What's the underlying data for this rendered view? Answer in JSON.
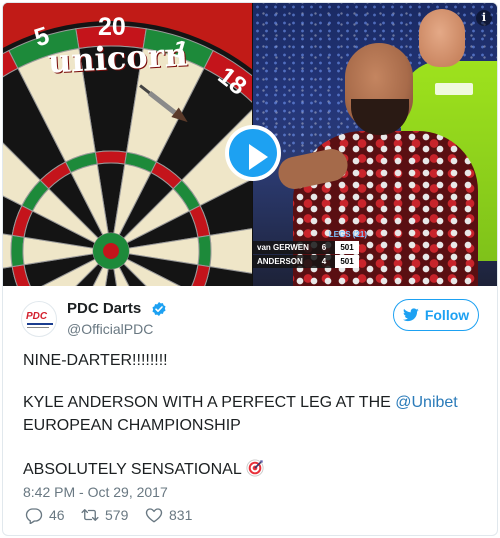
{
  "media": {
    "board_numbers": [
      "5",
      "20",
      "1",
      "18"
    ],
    "brand": "unicorn",
    "scoreboard": {
      "header": "LEGS (21)",
      "rows": [
        {
          "name": "van GERWEN",
          "legs": "6",
          "score": "501"
        },
        {
          "name": "ANDERSON",
          "legs": "4",
          "score": "501"
        }
      ]
    },
    "info_icon": "i",
    "play_icon": "play-icon"
  },
  "author": {
    "avatar_text": "PDC",
    "display_name": "PDC Darts",
    "handle": "@OfficialPDC",
    "verified_icon": "verified-badge-icon"
  },
  "follow_button": {
    "label": "Follow",
    "icon": "twitter-bird-icon"
  },
  "tweet": {
    "line1": "NINE-DARTER!!!!!!!!",
    "line2_prefix": "KYLE ANDERSON WITH A PERFECT LEG AT THE ",
    "line2_mention": "@Unibet",
    "line3": "EUROPEAN CHAMPIONSHIP",
    "line4": "ABSOLUTELY SENSATIONAL",
    "emoji_icon": "direct-hit-icon"
  },
  "timestamp": "8:42 PM - Oct 29, 2017",
  "actions": {
    "replies": "46",
    "retweets": "579",
    "likes": "831"
  },
  "colors": {
    "accent": "#1da1f2",
    "mention": "#2b7bb9",
    "muted": "#697882"
  }
}
